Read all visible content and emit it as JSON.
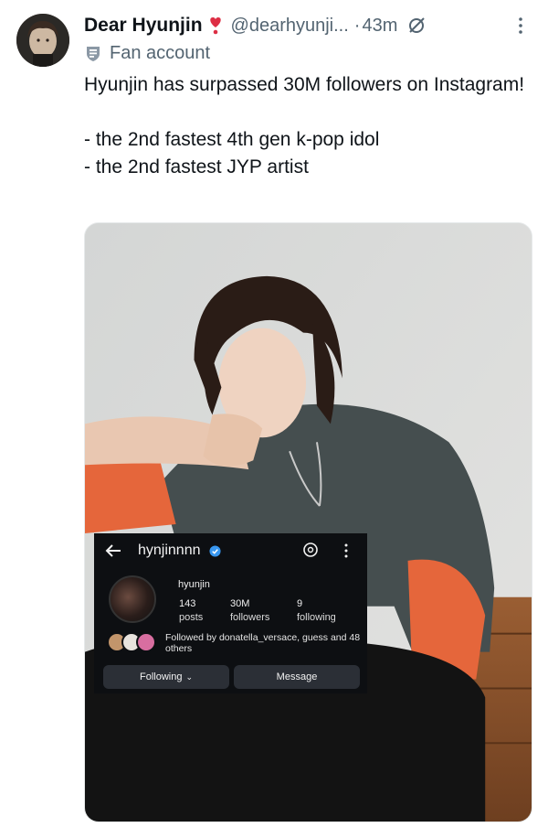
{
  "tweet": {
    "display_name": "Dear Hyunjin",
    "handle": "@dearhyunji...",
    "separator": "·",
    "time": "43m",
    "label": "Fan account",
    "text": "Hyunjin has surpassed 30M followers on Instagram!\n\n- the 2nd fastest 4th gen k-pop idol\n- the 2nd fastest JYP artist",
    "icons": {
      "name_badge": "heart-exclamation-icon",
      "status": "circle-slash-icon",
      "more": "vertical-ellipsis-icon",
      "label": "fan-account-badge-icon"
    },
    "colors": {
      "heart": "#dd2e44",
      "muted": "#536471"
    }
  },
  "instagram": {
    "username": "hynjinnnn",
    "name": "hyunjin",
    "stats": [
      {
        "num": "143",
        "label": "posts"
      },
      {
        "num": "30M",
        "label": "followers"
      },
      {
        "num": "9",
        "label": "following"
      }
    ],
    "followed_by": "Followed by donatella_versace, guess and 48 others",
    "buttons": {
      "follow": "Following",
      "follow_chevron": "⌄",
      "message": "Message"
    },
    "icons": {
      "back": "back-arrow-icon",
      "verified": "verified-badge-icon",
      "threads": "threads-icon",
      "menu": "vertical-ellipsis-icon"
    },
    "colors": {
      "verified": "#3897f0",
      "button_bg": "#2b2f36",
      "background": "#0d0f12"
    }
  }
}
